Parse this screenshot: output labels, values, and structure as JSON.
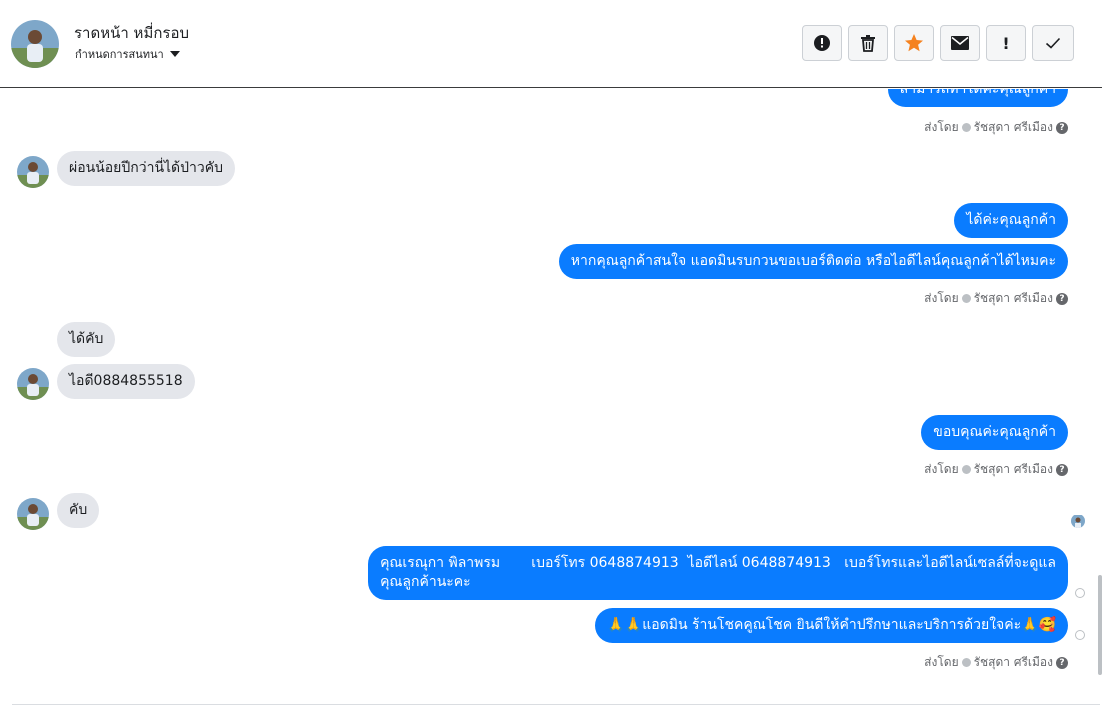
{
  "header": {
    "contact_name": "ราดหน้า หมี่กรอบ",
    "assign_label": "กำหนดการสนทนา",
    "actions": [
      {
        "icon": "alert-circle-icon"
      },
      {
        "icon": "trash-icon"
      },
      {
        "icon": "star-icon"
      },
      {
        "icon": "envelope-icon"
      },
      {
        "icon": "exclamation-icon",
        "text": "!"
      },
      {
        "icon": "checkmark-icon"
      }
    ]
  },
  "messages": {
    "m0_out": "สามารถทำได้ค่ะคุณลูกค้า",
    "sent0": "ส่งโดย",
    "sender0": "รัชสุดา ศรีเมือง",
    "m1_in": "ผ่อนน้อยปีกว่านี่ได้ป่าวคับ",
    "m2_out": "ได้ค่ะคุณลูกค้า",
    "m3_out": "หากคุณลูกค้าสนใจ แอดมินรบกวนขอเบอร์ติดต่อ หรือไอดีไลน์คุณลูกค้าได้ไหมคะ",
    "sent1": "ส่งโดย",
    "sender1": "รัชสุดา ศรีเมือง",
    "m4_in": "ได้คับ",
    "m5_in": "ไอดี0884855518",
    "m6_out": "ขอบคุณค่ะคุณลูกค้า",
    "sent2": "ส่งโดย",
    "sender2": "รัชสุดา ศรีเมือง",
    "m7_in": "คับ",
    "m8_out_line1": "คุณเรณุกา พิลาพรม       เบอร์โทร 0648874913  ไอดีไลน์ 0648874913   เบอร์โทรและไอดีไลน์เซลล์ที่จะดูแล",
    "m8_out_line2": "คุณลูกค้านะคะ",
    "m9_out": "🙏🙏แอดมิน ร้านโชคคูณโชค ยินดีให้คำปรึกษาและบริการด้วยใจค่ะ🙏🥰",
    "sent3": "ส่งโดย",
    "sender3": "รัชสุดา ศรีเมือง"
  },
  "colors": {
    "outgoing_bubble": "#0a7cff",
    "incoming_bubble": "#e4e6eb",
    "star": "#f5821f"
  }
}
